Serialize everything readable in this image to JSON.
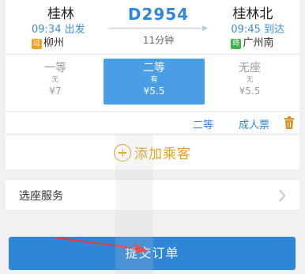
{
  "train": {
    "departure": {
      "station": "桂林",
      "time_label": "09:34 出发",
      "via_badge": "过",
      "via_station": "柳州"
    },
    "number": "D2954",
    "duration": "11分钟",
    "arrival": {
      "station": "桂林北",
      "time_label": "09:45 到达",
      "via_badge": "终",
      "via_station": "广州南"
    }
  },
  "seats": [
    {
      "name": "一等",
      "availability": "无",
      "price": "¥7"
    },
    {
      "name": "二等",
      "availability": "有",
      "price": "¥5.5"
    },
    {
      "name": "无座",
      "availability": "无",
      "price": "¥5.5"
    }
  ],
  "selected_seat_index": 1,
  "passenger": {
    "seat_class": "二等",
    "ticket_type": "成人票"
  },
  "add_passenger_label": "添加乘客",
  "seat_service_label": "选座服务",
  "submit_label": "提交订单",
  "colors": {
    "accent_blue": "#2f86d8",
    "selected_seat_bg": "#4a9ee6",
    "add_passenger": "#e3a31c",
    "trash_icon": "#e08a1e",
    "annotation_arrow": "#e53935"
  },
  "icons": {
    "trash": "trash-icon",
    "plus": "plus-circle-icon",
    "chevron": "chevron-right-icon"
  }
}
